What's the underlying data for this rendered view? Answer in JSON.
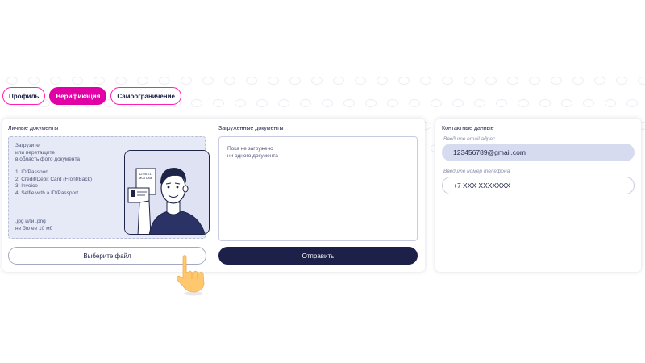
{
  "tabs": [
    {
      "label": "Профиль",
      "active": false
    },
    {
      "label": "Верификация",
      "active": true
    },
    {
      "label": "Самоограничение",
      "active": false
    }
  ],
  "personal_docs": {
    "title": "Личные документы",
    "instructions": [
      "Загрузите",
      "или перетащите",
      "в область фото документа"
    ],
    "list": [
      "1. ID/Passport",
      "2. Credit/Debit Card (Front/Back)",
      "3. Invoice",
      "4. Selfie with a ID/Passport"
    ],
    "format": [
      ".jpg или .png",
      "не более 10 мб"
    ],
    "card_text": [
      "12.05.21",
      "MOTUNE"
    ],
    "choose_button": "Выберите файл"
  },
  "uploaded_docs": {
    "title": "Загруженные документы",
    "empty": [
      "Пока не загружено",
      "ни одного документа"
    ],
    "send_button": "Отправить"
  },
  "contacts": {
    "title": "Контактные данные",
    "email_label": "Введите email адрес",
    "email_value": "123456789@gmail.com",
    "phone_label": "Введите номер телефона",
    "phone_value": "+7 XXX XXXXXXX"
  },
  "colors": {
    "accent": "#e100a5",
    "navy": "#1d2048",
    "dropzone": "#e6e9f6",
    "email_field": "#d7dbef",
    "hand": "#ffc86e"
  },
  "icons": [
    "pointer-hand-icon",
    "background-pattern-icon"
  ]
}
